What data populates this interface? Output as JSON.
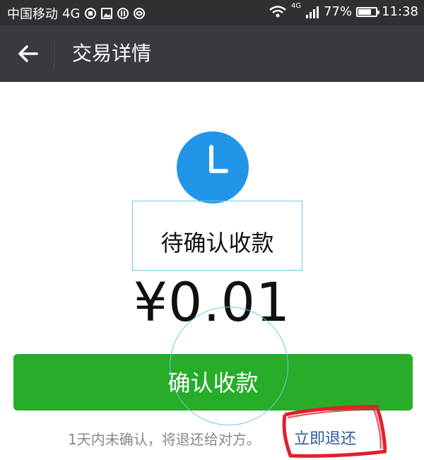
{
  "statusbar": {
    "carrier": "中国移动",
    "network": "4G",
    "network_small": "4G",
    "battery_percent": "77%",
    "battery_level": 0.77,
    "time": "11:38",
    "icons": [
      "sim-icon",
      "image-icon",
      "notification-icon",
      "settings-icon",
      "wifi-icon",
      "signal-icon",
      "battery-icon"
    ]
  },
  "header": {
    "back_icon": "arrow-left-icon",
    "title": "交易详情"
  },
  "main": {
    "status_icon": "clock-icon",
    "status_text": "待确认收款",
    "amount": "¥0.01",
    "confirm_button": "确认收款",
    "note": "1天内未确认，将退还给对方。",
    "refund_link": "立即退还"
  },
  "colors": {
    "accent_green": "#27ad2a",
    "clock_blue": "#2196e8",
    "link_blue": "#2f5a9e",
    "annotation_red": "#e0202c"
  }
}
